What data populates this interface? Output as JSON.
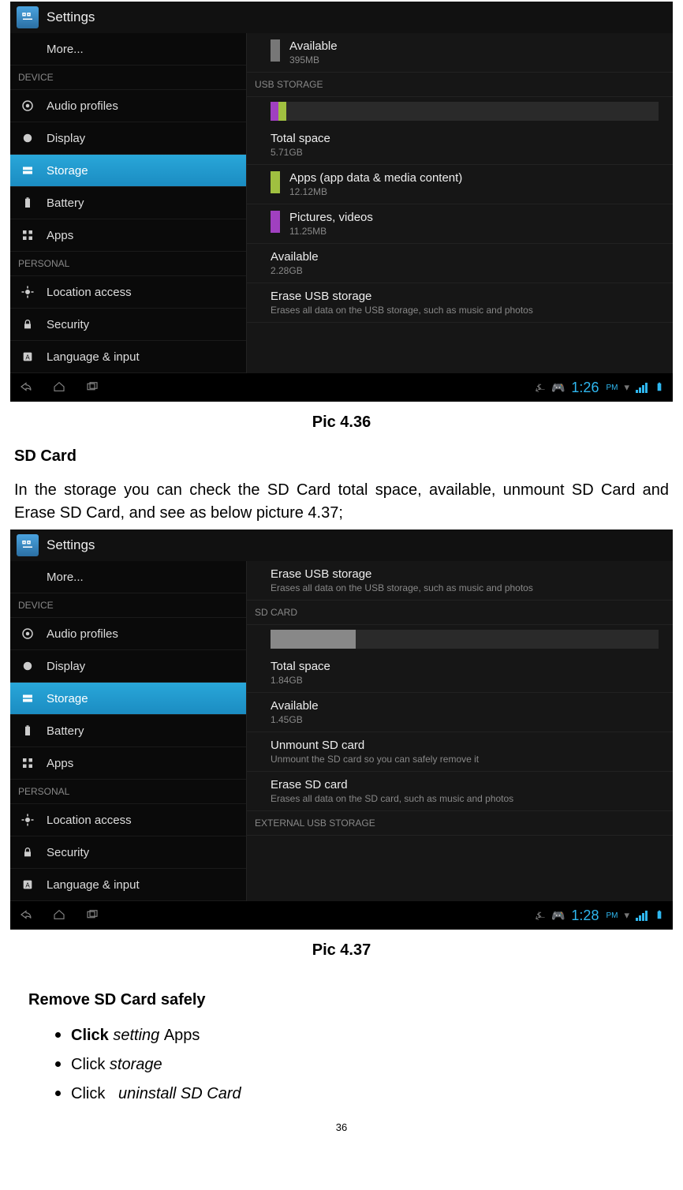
{
  "app_title": "Settings",
  "sidebar": {
    "more": "More...",
    "cat_device": "DEVICE",
    "audio": "Audio profiles",
    "display": "Display",
    "storage": "Storage",
    "battery": "Battery",
    "apps": "Apps",
    "cat_personal": "PERSONAL",
    "location": "Location access",
    "security": "Security",
    "language": "Language & input"
  },
  "shot1": {
    "available_top": "Available",
    "available_top_sub": "395MB",
    "usb_header": "USB STORAGE",
    "total": "Total space",
    "total_sub": "5.71GB",
    "apps": "Apps (app data & media content)",
    "apps_sub": "12.12MB",
    "pics": "Pictures, videos",
    "pics_sub": "11.25MB",
    "available": "Available",
    "available_sub": "2.28GB",
    "erase": "Erase USB storage",
    "erase_sub": "Erases all data on the USB storage, such as music and photos",
    "time": "1:26",
    "ampm": "PM"
  },
  "shot2": {
    "erase_usb": "Erase USB storage",
    "erase_usb_sub": "Erases all data on the USB storage, such as music and photos",
    "sd_header": "SD CARD",
    "total": "Total space",
    "total_sub": "1.84GB",
    "available": "Available",
    "available_sub": "1.45GB",
    "unmount": "Unmount SD card",
    "unmount_sub": "Unmount the SD card so you can safely remove it",
    "erase_sd": "Erase SD card",
    "erase_sd_sub": "Erases all data on the SD card, such as music and photos",
    "ext_header": "EXTERNAL USB STORAGE",
    "time": "1:28",
    "ampm": "PM"
  },
  "doc": {
    "caption1": "Pic 4.36",
    "sd_heading": "SD Card",
    "sd_para": "In the storage you can check the SD Card total space, available, unmount SD Card and Erase SD Card, and see as below picture 4.37;",
    "caption2": "Pic 4.37",
    "remove_heading": "Remove SD Card safely",
    "b1_bold": "Click ",
    "b1_italic": "setting ",
    "b1_rest": "Apps",
    "b2_plain": "Click ",
    "b2_italic": "storage",
    "b3_plain": "Click   ",
    "b3_italic": "uninstall SD Card",
    "page": "36"
  }
}
